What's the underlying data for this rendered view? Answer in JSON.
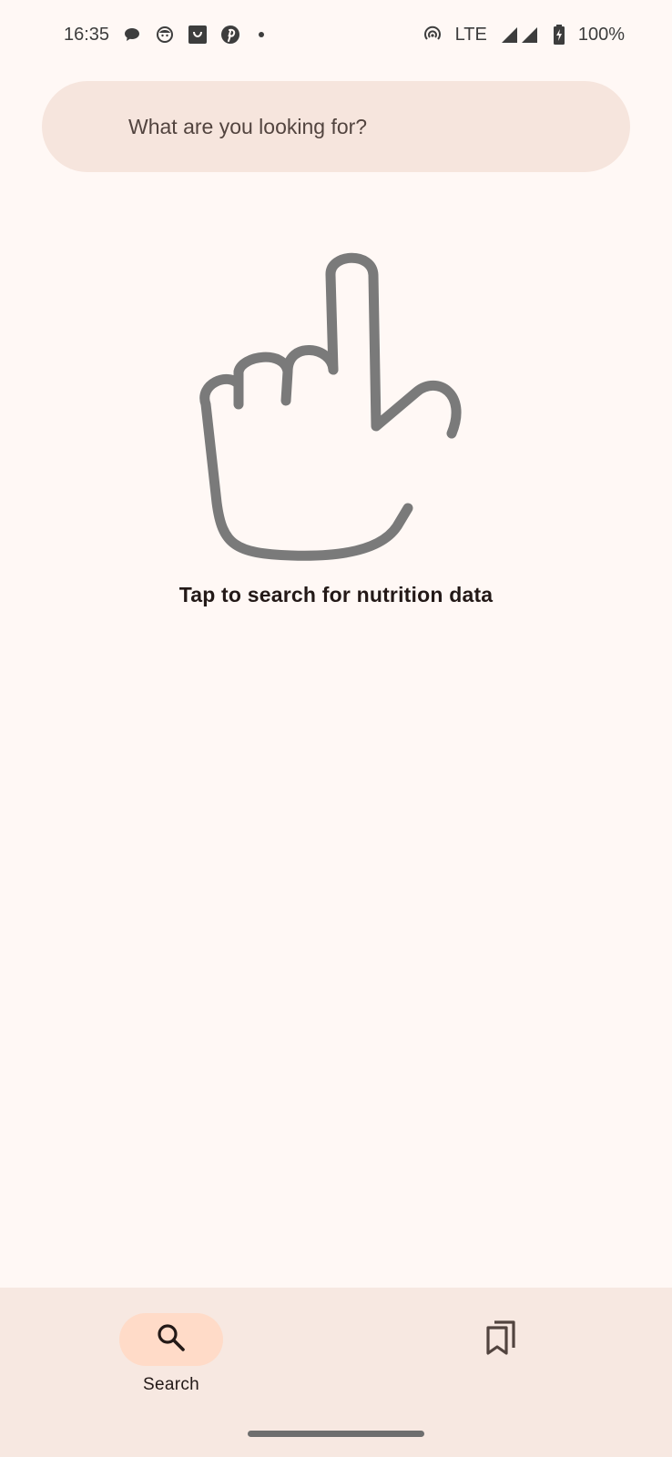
{
  "status_bar": {
    "time": "16:35",
    "network": "LTE",
    "battery": "100%",
    "notification_icons": [
      "chat-bubble-icon",
      "face-icon",
      "shopping-bag-icon",
      "pinterest-icon"
    ]
  },
  "search": {
    "placeholder": "What are you looking for?"
  },
  "empty_state": {
    "illustration": "pointing-hand-icon",
    "message": "Tap to search for nutrition data"
  },
  "bottom_nav": {
    "items": [
      {
        "label": "Search",
        "icon": "search-icon",
        "active": true
      },
      {
        "label": "",
        "icon": "bookmarks-icon",
        "active": false
      }
    ]
  },
  "colors": {
    "background": "#fff8f5",
    "search_bar": "#f6e5dd",
    "nav_background": "#f7e8e1",
    "active_pill": "#ffdbc8",
    "illustration_stroke": "#7a7a7a"
  }
}
